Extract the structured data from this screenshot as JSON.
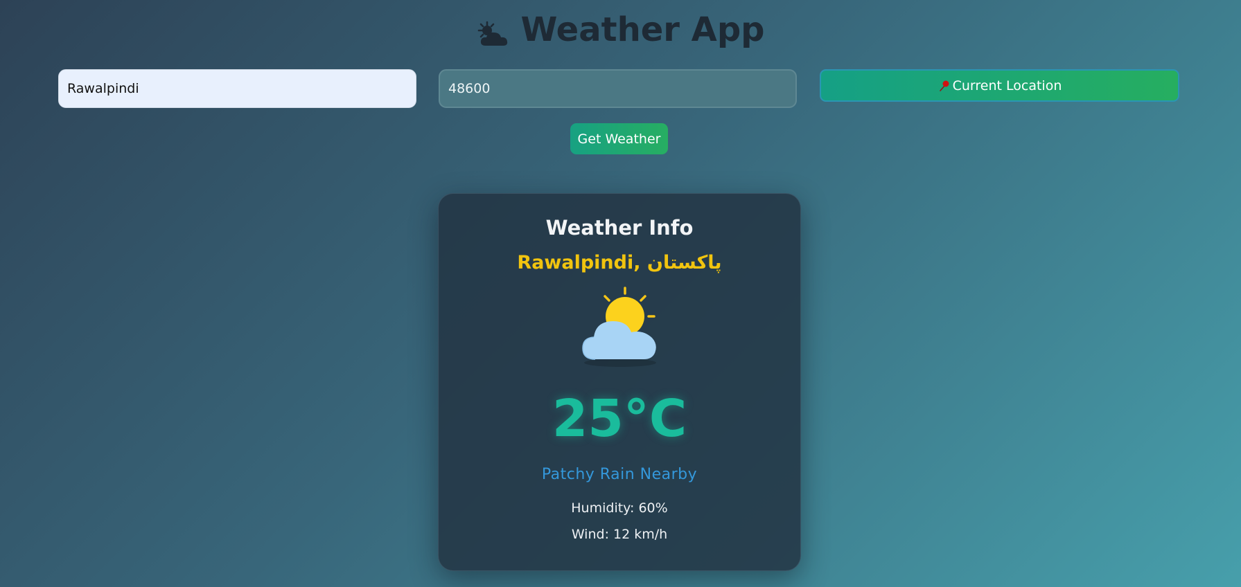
{
  "header": {
    "title": "Weather App",
    "icon": "sun-behind-cloud-icon"
  },
  "search": {
    "city_value": "Rawalpindi",
    "zip_value": "48600",
    "location_button_label": "Current Location",
    "location_icon": "round-pushpin-icon",
    "get_weather_label": "Get Weather"
  },
  "card": {
    "title": "Weather Info",
    "location": "Rawalpindi, پاکستان",
    "icon": "partly-cloudy-icon",
    "temperature": "25°C",
    "condition": "Patchy Rain Nearby",
    "humidity": "Humidity: 60%",
    "wind": "Wind: 12 km/h"
  },
  "colors": {
    "accent_green": "#1abc9c",
    "location_yellow": "#f1c40f",
    "condition_blue": "#3498db",
    "button_green": "#27ae60"
  }
}
